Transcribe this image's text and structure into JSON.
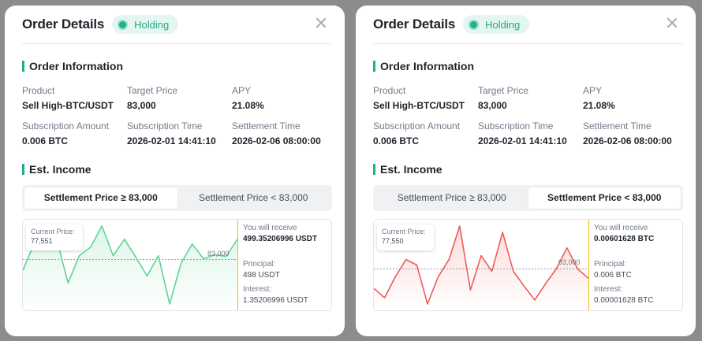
{
  "left": {
    "title": "Order Details",
    "status_badge": "Holding",
    "order_info_title": "Order Information",
    "fields": [
      {
        "label": "Product",
        "value": "Sell High-BTC/USDT"
      },
      {
        "label": "Target Price",
        "value": "83,000"
      },
      {
        "label": "APY",
        "value": "21.08%"
      },
      {
        "label": "Subscription Amount",
        "value": "0.006 BTC"
      },
      {
        "label": "Subscription Time",
        "value": "2026-02-01 14:41:10"
      },
      {
        "label": "Settlement Time",
        "value": "2026-02-06 08:00:00"
      }
    ],
    "est_income_title": "Est. Income",
    "tabs": [
      {
        "label": "Settlement Price ≥ 83,000",
        "active": true
      },
      {
        "label": "Settlement Price < 83,000",
        "active": false
      }
    ],
    "tooltip": {
      "label": "Current Price:",
      "value": "77,551"
    },
    "target_line_label": "83,000",
    "receive_label": "You will receive",
    "receive_value": "499.35206996 USDT",
    "principal_label": "Principal:",
    "principal_value": "498 USDT",
    "interest_label": "Interest:",
    "interest_value": "1.35206996 USDT",
    "line_color": "#5ed394",
    "fill_color": "#5ed394",
    "divider_color": "#f0b90b",
    "price_series": [
      0.43,
      0.78,
      0.72,
      0.83,
      0.27,
      0.62,
      0.73,
      1.0,
      0.62,
      0.83,
      0.6,
      0.36,
      0.62,
      0.0,
      0.52,
      0.77,
      0.58,
      0.63,
      0.61,
      0.83
    ],
    "target_level": 0.57
  },
  "right": {
    "title": "Order Details",
    "status_badge": "Holding",
    "order_info_title": "Order Information",
    "fields": [
      {
        "label": "Product",
        "value": "Sell High-BTC/USDT"
      },
      {
        "label": "Target Price",
        "value": "83,000"
      },
      {
        "label": "APY",
        "value": "21.08%"
      },
      {
        "label": "Subscription Amount",
        "value": "0.006 BTC"
      },
      {
        "label": "Subscription Time",
        "value": "2026-02-01 14:41:10"
      },
      {
        "label": "Settlement Time",
        "value": "2026-02-06 08:00:00"
      }
    ],
    "est_income_title": "Est. Income",
    "tabs": [
      {
        "label": "Settlement Price ≥ 83,000",
        "active": false
      },
      {
        "label": "Settlement Price < 83,000",
        "active": true
      }
    ],
    "tooltip": {
      "label": "Current Price:",
      "value": "77,550"
    },
    "target_line_label": "83,000",
    "receive_label": "You will receive",
    "receive_value": "0.00601628 BTC",
    "principal_label": "Principal:",
    "principal_value": "0.006 BTC",
    "interest_label": "Interest:",
    "interest_value": "0.00001628 BTC",
    "line_color": "#ef5a5a",
    "fill_color": "#ef5a5a",
    "divider_color": "#f0b90b",
    "price_series": [
      0.2,
      0.08,
      0.35,
      0.57,
      0.5,
      0.0,
      0.35,
      0.57,
      1.0,
      0.18,
      0.62,
      0.42,
      0.92,
      0.42,
      0.23,
      0.05,
      0.26,
      0.45,
      0.72,
      0.45,
      0.33
    ],
    "target_level": 0.45
  }
}
